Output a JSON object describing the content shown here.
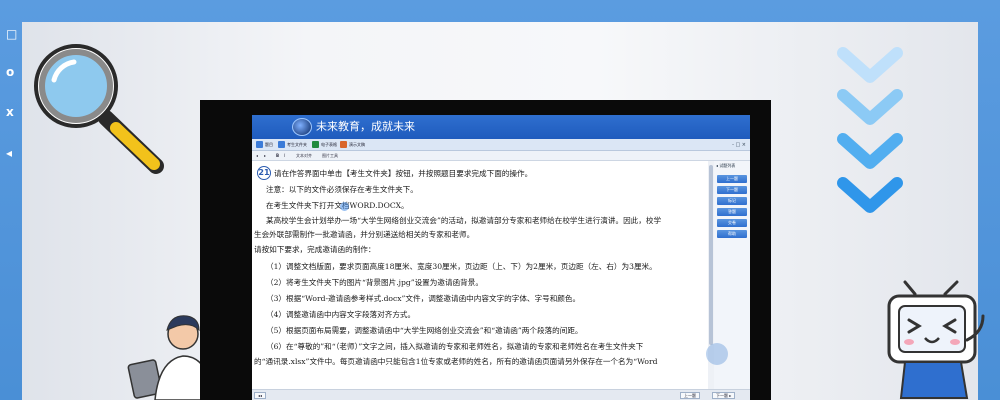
{
  "rail_icons": [
    "□",
    "o",
    "x",
    "◂"
  ],
  "app": {
    "title": "未来教育，成就未来",
    "tabs": [
      {
        "label": "题目",
        "color": "#3b7bd8"
      },
      {
        "label": "考生文件夹",
        "color": "#3b7bd8"
      },
      {
        "label": "电子表格",
        "color": "#1f8a3f"
      },
      {
        "label": "演示文稿",
        "color": "#d9652a"
      }
    ],
    "window_controls": "- □ ×",
    "subtoolbar": [
      "◂",
      "▸",
      "B",
      "I",
      "文本对齐",
      "图片工具"
    ],
    "question_number": "21",
    "doc_lines": [
      "请在作答界面中单击【考生文件夹】按钮，并按照题目要求完成下面的操作。",
      "注意：以下的文件必须保存在考生文件夹下。",
      "在考生文件夹下打开文档WORD.DOCX。",
      "某高校学生会计划举办一场“大学生网络创业交流会”的活动，拟邀请部分专家和老师给在校学生进行演讲。因此，校学",
      "生会外联部需制作一批邀请函，并分别递送给相关的专家和老师。",
      "请按如下要求，完成邀请函的制作：",
      "（1）调整文档版面，要求页面高度18厘米、宽度30厘米，页边距（上、下）为2厘米，页边距（左、右）为3厘米。",
      "（2）将考生文件夹下的图片“背景图片.jpg”设置为邀请函背景。",
      "（3）根据“Word-邀请函参考样式.docx”文件，调整邀请函中内容文字的字体、字号和颜色。",
      "（4）调整邀请函中内容文字段落对齐方式。",
      "（5）根据页面布局需要，调整邀请函中“大学生网络创业交流会”和“邀请函”两个段落的间距。",
      "（6）在“尊敬的”和“（老师）”文字之间，插入拟邀请的专家和老师姓名，拟邀请的专家和老师姓名在考生文件夹下",
      "的“通讯录.xlsx”文件中。每页邀请函中只能包含1位专家或老师的姓名，所有的邀请函页面请另外保存在一个名为“Word"
    ],
    "side_head": "◂ 试题列表",
    "side_buttons": [
      "上一题",
      "下一题",
      "标记",
      "答题",
      "交卷",
      "帮助"
    ],
    "status": {
      "left_button": "◂◂",
      "prev": "上一题",
      "next": "下一题 ▸"
    }
  }
}
